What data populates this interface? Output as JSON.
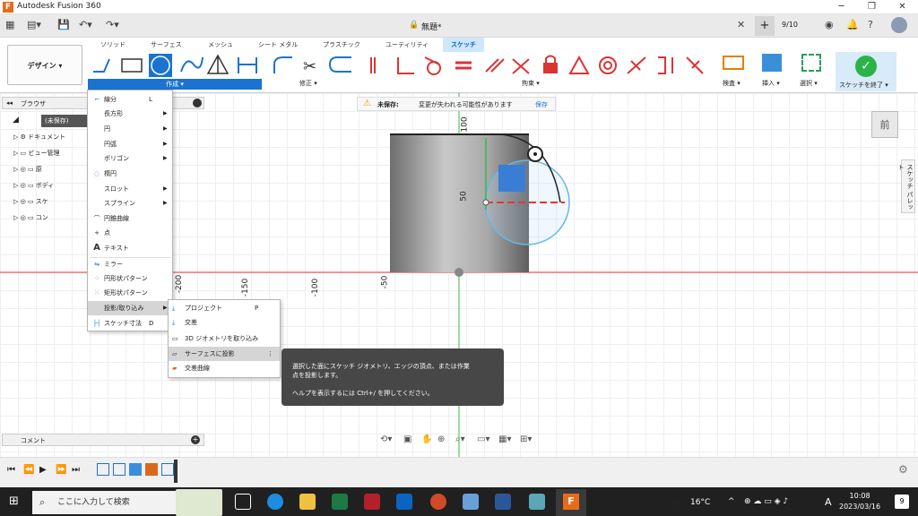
{
  "window": {
    "title": "Autodesk Fusion 360",
    "min": "─",
    "max": "❐",
    "close": "✕"
  },
  "qat": {
    "doc_title": "無題*",
    "job_status": "9/10",
    "lock_icon": "lock-icon"
  },
  "ribbon": {
    "tabs": [
      "ソリッド",
      "サーフェス",
      "メッシュ",
      "シート メタル",
      "プラスチック",
      "ユーティリティ"
    ],
    "active_tab": "スケッチ",
    "design_button": "デザイン ▾",
    "groups": {
      "create": "作成 ▾",
      "modify": "修正 ▾",
      "constraints": "拘束 ▾",
      "inspect": "検査 ▾",
      "insert": "挿入 ▾",
      "select": "選択 ▾",
      "finish": "スケッチを終了 ▾"
    }
  },
  "browser": {
    "title": "ブラウザ",
    "items": [
      "(未保存)",
      "ドキュメント",
      "ビュー管理",
      "原",
      "ボディ",
      "スケ",
      "コン"
    ]
  },
  "warning": {
    "label": "未保存:",
    "message": "変更が失われる可能性があります",
    "save": "保存"
  },
  "create_menu": {
    "items": [
      {
        "label": "線分",
        "shortcut": "L",
        "icon": "⌐",
        "arrow": ""
      },
      {
        "label": "長方形",
        "shortcut": "",
        "icon": "",
        "arrow": "▶"
      },
      {
        "label": "円",
        "shortcut": "",
        "icon": "",
        "arrow": "▶"
      },
      {
        "label": "円弧",
        "shortcut": "",
        "icon": "",
        "arrow": "▶"
      },
      {
        "label": "ポリゴン",
        "shortcut": "",
        "icon": "",
        "arrow": "▶"
      },
      {
        "label": "楕円",
        "shortcut": "",
        "icon": "◌",
        "arrow": ""
      },
      {
        "label": "スロット",
        "shortcut": "",
        "icon": "",
        "arrow": "▶"
      },
      {
        "label": "スプライン",
        "shortcut": "",
        "icon": "",
        "arrow": "▶"
      },
      {
        "label": "円錐曲線",
        "shortcut": "",
        "icon": "⌒",
        "arrow": ""
      },
      {
        "label": "点",
        "shortcut": "",
        "icon": "+",
        "arrow": ""
      },
      {
        "label": "テキスト",
        "shortcut": "",
        "icon": "A",
        "arrow": ""
      },
      {
        "label": "ミラー",
        "shortcut": "",
        "icon": "⇋",
        "arrow": ""
      },
      {
        "label": "円形状パターン",
        "shortcut": "",
        "icon": "⁘",
        "arrow": ""
      },
      {
        "label": "矩形状パターン",
        "shortcut": "",
        "icon": "⁙",
        "arrow": ""
      },
      {
        "label": "投影/取り込み",
        "shortcut": "",
        "icon": "",
        "arrow": "▶"
      },
      {
        "label": "スケッチ寸法",
        "shortcut": "D",
        "icon": "├┤",
        "arrow": ""
      }
    ]
  },
  "submenu": {
    "items": [
      {
        "label": "プロジェクト",
        "shortcut": "P"
      },
      {
        "label": "交差",
        "shortcut": ""
      },
      {
        "label": "3D ジオメトリを取り込み",
        "shortcut": ""
      },
      {
        "label": "サーフェスに投影",
        "shortcut": "⋮"
      },
      {
        "label": "交差曲線",
        "shortcut": ""
      }
    ]
  },
  "tooltip": {
    "line1": "選択した面にスケッチ ジオメトリ、エッジの頂点、または作業",
    "line2": "点を投影します。",
    "line3": "ヘルプを表示するには Ctrl+/ を押してください。"
  },
  "axis": {
    "x": [
      "-200",
      "-150",
      "-100",
      "-50"
    ],
    "y": [
      "100",
      "50"
    ]
  },
  "comment": {
    "label": "コメント"
  },
  "viewcube": {
    "face": "前"
  },
  "palette": {
    "label": "スケッチ パレット"
  },
  "taskbar": {
    "search": "ここに入力して検索",
    "weather": "16°C",
    "ime": "A",
    "time": "10:08",
    "date": "2023/03/16",
    "notif": "9"
  }
}
